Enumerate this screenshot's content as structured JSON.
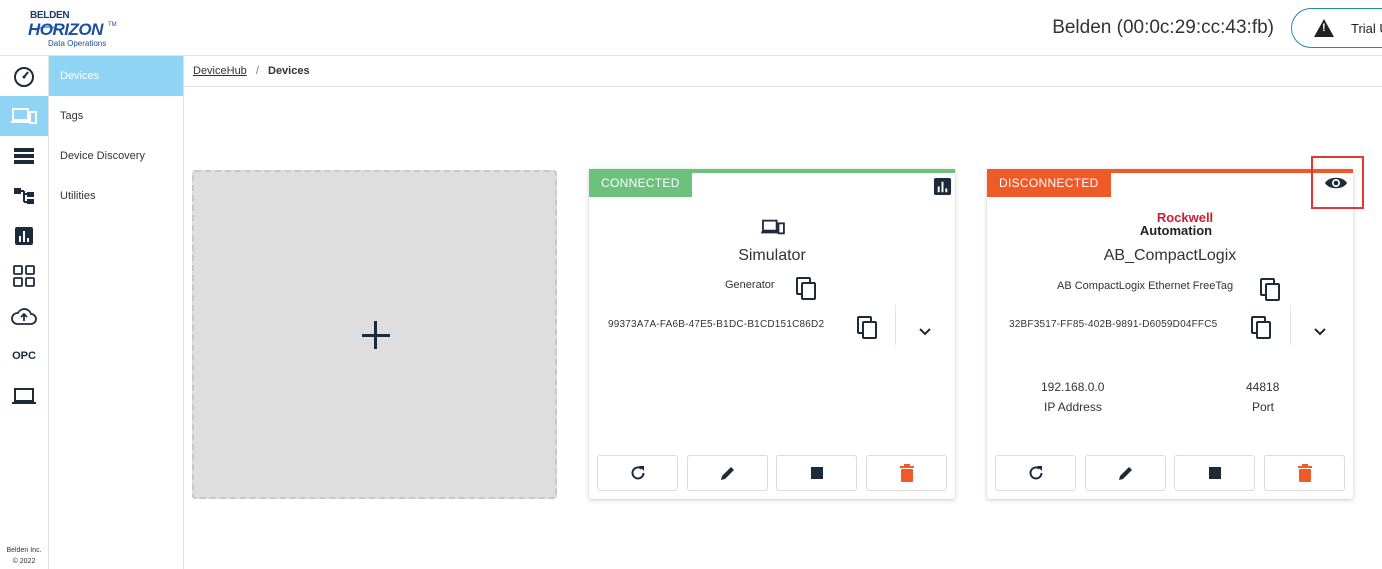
{
  "header": {
    "logo": {
      "brand": "BELDEN",
      "product": "HORIZON",
      "trademark": "TM",
      "tagline": "Data Operations"
    },
    "device_title": "Belden (00:0c:29:cc:43:fb)",
    "trial_label": "Trial U",
    "trial_icon": "warning-icon"
  },
  "rail": {
    "items": [
      {
        "icon": "dashboard-gauge-icon"
      },
      {
        "icon": "devices-icon",
        "active": true
      },
      {
        "icon": "storage-list-icon"
      },
      {
        "icon": "hierarchy-icon"
      },
      {
        "icon": "bar-chart-icon"
      },
      {
        "icon": "grid-apps-icon"
      },
      {
        "icon": "cloud-upload-icon"
      },
      {
        "label": "OPC"
      },
      {
        "icon": "laptop-icon"
      }
    ],
    "footer_line1": "Belden Inc.",
    "footer_line2": "© 2022"
  },
  "submenu": {
    "items": [
      {
        "label": "Devices",
        "active": true
      },
      {
        "label": "Tags"
      },
      {
        "label": "Device Discovery"
      },
      {
        "label": "Utilities"
      }
    ]
  },
  "breadcrumb": {
    "root": "DeviceHub",
    "separator": "/",
    "current": "Devices"
  },
  "cards": [
    {
      "status": "CONNECTED",
      "status_color": "#6cc17c",
      "name": "Simulator",
      "driver": "Generator",
      "uuid": "99373A7A-FA6B-47E5-B1DC-B1CD151C86D2"
    },
    {
      "status": "DISCONNECTED",
      "status_color": "#f05a28",
      "brand_line1": "Rockwell",
      "brand_line2": "Automation",
      "name": "AB_CompactLogix",
      "driver": "AB CompactLogix Ethernet FreeTag",
      "uuid": "32BF3517-FF85-402B-9891-D6059D04FFC5",
      "ip_value": "192.168.0.0",
      "ip_label": "IP Address",
      "port_value": "44818",
      "port_label": "Port"
    }
  ],
  "colors": {
    "accent": "#90d4f5",
    "delete": "#f05a28",
    "icon_dark": "#1b2b3a",
    "highlight": "#e03838"
  }
}
